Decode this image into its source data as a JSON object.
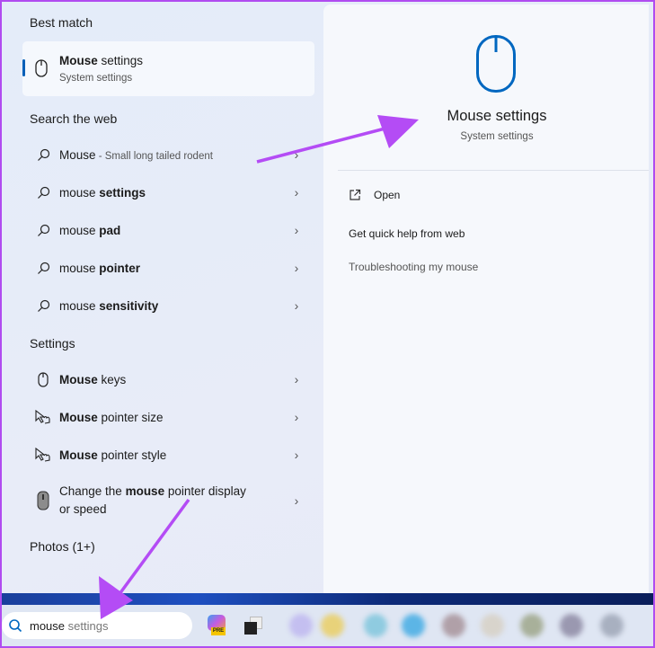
{
  "left": {
    "best_match_header": "Best match",
    "best_match": {
      "title_bold": "Mouse",
      "title_rest": " settings",
      "subtitle": "System settings",
      "icon": "mouse-icon"
    },
    "web_header": "Search the web",
    "web_items": [
      {
        "pre": "Mouse",
        "bold": "",
        "sub": " - Small long tailed rodent",
        "icon": "search-icon"
      },
      {
        "pre": "mouse ",
        "bold": "settings",
        "sub": "",
        "icon": "search-icon"
      },
      {
        "pre": "mouse ",
        "bold": "pad",
        "sub": "",
        "icon": "search-icon"
      },
      {
        "pre": "mouse ",
        "bold": "pointer",
        "sub": "",
        "icon": "search-icon"
      },
      {
        "pre": "mouse ",
        "bold": "sensitivity",
        "sub": "",
        "icon": "search-icon"
      }
    ],
    "settings_header": "Settings",
    "settings_items": [
      {
        "bold": "Mouse",
        "rest": " keys",
        "icon": "mouse-icon"
      },
      {
        "bold": "Mouse",
        "rest": " pointer size",
        "icon": "pointer-hand-icon"
      },
      {
        "bold": "Mouse",
        "rest": " pointer style",
        "icon": "pointer-hand-icon"
      },
      {
        "pre": "Change the ",
        "bold": "mouse",
        "rest": " pointer display",
        "line2": "or speed",
        "icon": "mouse-device-icon"
      }
    ],
    "photos_header": "Photos (1+)"
  },
  "right": {
    "title": "Mouse settings",
    "subtitle": "System settings",
    "open": "Open",
    "quick_help": "Get quick help from web",
    "troubleshoot": "Troubleshooting my mouse"
  },
  "taskbar": {
    "search_typed": "mouse",
    "search_suggest": " settings",
    "copilot_badge": "PRE"
  },
  "colors": {
    "accent": "#005fb8",
    "annotation": "#b04cf0"
  }
}
